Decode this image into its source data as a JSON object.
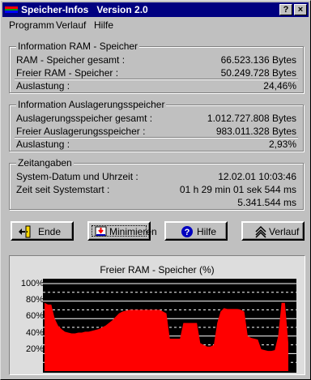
{
  "window": {
    "title": "Speicher-Infos   Version 2.0",
    "help_button": "?",
    "close_button": "×"
  },
  "menu": [
    "Programm",
    "Verlauf",
    "Hilfe"
  ],
  "ram": {
    "title": "Information RAM - Speicher",
    "rows": [
      {
        "label": "RAM - Speicher gesamt :",
        "value": "66.523.136 Bytes"
      },
      {
        "label": "Freier RAM - Speicher :",
        "value": "50.249.728 Bytes"
      },
      {
        "label": "Auslastung :",
        "value": "24,46%"
      }
    ]
  },
  "swap": {
    "title": "Information  Auslagerungsspeicher",
    "rows": [
      {
        "label": "Auslagerungsspeicher gesamt :",
        "value": "1.012.727.808 Bytes"
      },
      {
        "label": "Freier Auslagerungsspeicher :",
        "value": "983.011.328 Bytes"
      },
      {
        "label": "Auslastung :",
        "value": "2,93%"
      }
    ]
  },
  "time": {
    "title": "Zeitangaben",
    "rows": [
      {
        "label": "System-Datum und Uhrzeit :",
        "value": "12.02.01 10:03:46"
      },
      {
        "label": "Zeit seit Systemstart :",
        "value": "01 h  29 min  01 sek  544 ms"
      }
    ],
    "ms_total": "5.341.544 ms"
  },
  "buttons": {
    "ende": "Ende",
    "minimieren": "Minimieren",
    "hilfe": "Hilfe",
    "verlauf": "Verlauf"
  },
  "chart_data": {
    "type": "area",
    "title": "Freier RAM - Speicher  (%)",
    "xlabel": "",
    "ylabel": "",
    "ylim": [
      0,
      100
    ],
    "yticks": [
      "100%",
      "80%",
      "60%",
      "40%",
      "20%"
    ],
    "grid": true,
    "color": "#ff0000",
    "series": [
      {
        "values": [
          78,
          76,
          76,
          60,
          52,
          48,
          45,
          44,
          43,
          43,
          44,
          44,
          45,
          45,
          46,
          47,
          48,
          50,
          52,
          55,
          58,
          62,
          66,
          68,
          69,
          70,
          70,
          70,
          70,
          70,
          70,
          70,
          70,
          70,
          70,
          68,
          66,
          37,
          37,
          37,
          37,
          55,
          55,
          55,
          55,
          55,
          32,
          30,
          28,
          28,
          30,
          55,
          68,
          72,
          71,
          71,
          71,
          71,
          70,
          68,
          40,
          38,
          37,
          36,
          25,
          24,
          23,
          23,
          24,
          40,
          78,
          78,
          32
        ]
      }
    ]
  }
}
